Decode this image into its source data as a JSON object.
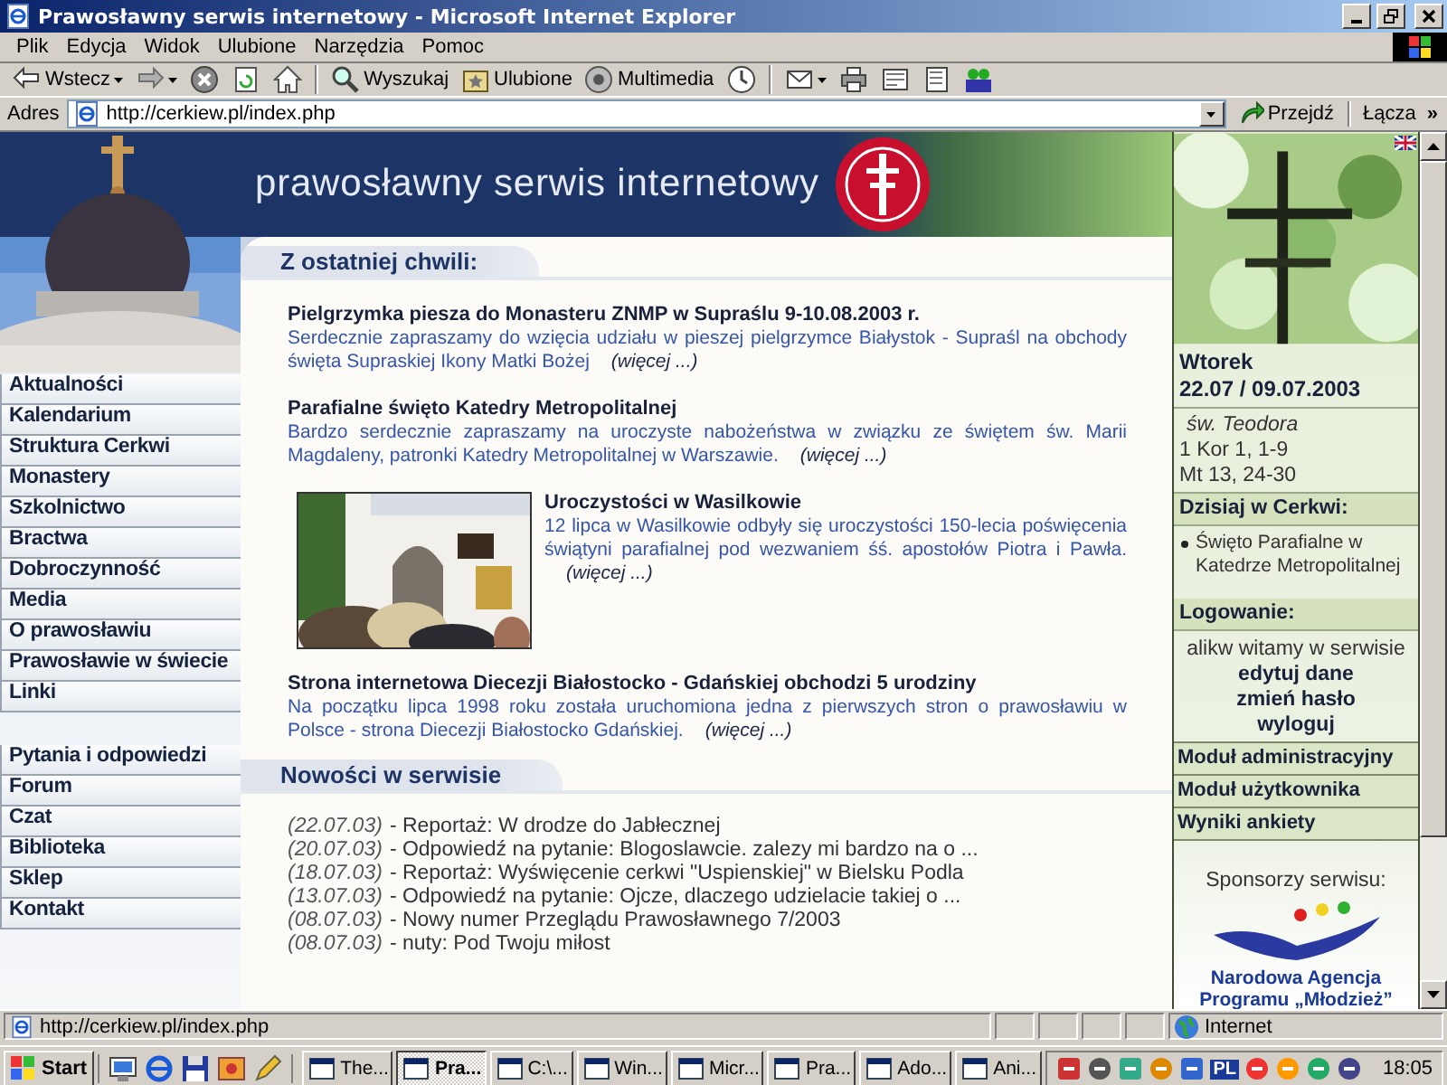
{
  "window": {
    "title": "Prawosławny serwis internetowy - Microsoft Internet Explorer"
  },
  "menu": [
    "Plik",
    "Edycja",
    "Widok",
    "Ulubione",
    "Narzędzia",
    "Pomoc"
  ],
  "toolbar": {
    "back": "Wstecz",
    "search": "Wyszukaj",
    "favorites": "Ulubione",
    "media": "Multimedia"
  },
  "address": {
    "label": "Adres",
    "value": "http://cerkiew.pl/index.php",
    "go": "Przejdź",
    "links": "Łącza",
    "links_more": "»"
  },
  "site": {
    "title": "prawosławny serwis internetowy",
    "nav_primary": [
      "Aktualności",
      "Kalendarium",
      "Struktura Cerkwi",
      "Monastery",
      "Szkolnictwo",
      "Bractwa",
      "Dobroczynność",
      "Media",
      "O prawosławiu",
      "Prawosławie w świecie",
      "Linki"
    ],
    "nav_secondary": [
      "Pytania i odpowiedzi",
      "Forum",
      "Czat",
      "Biblioteka",
      "Sklep",
      "Kontakt"
    ],
    "news": {
      "heading": "Z ostatniej chwili:",
      "items": [
        {
          "kind": "text",
          "title": "Pielgrzymka piesza do Monasteru ZNMP w Supraślu 9-10.08.2003 r.",
          "summary": "Serdecznie zapraszamy do wzięcia udziału w pieszej pielgrzymce Białystok - Supraśl na obchody święta Supraskiej Ikony Matki Bożej",
          "more": "(więcej ...)"
        },
        {
          "kind": "text",
          "title": "Parafialne święto Katedry Metropolitalnej",
          "summary": "Bardzo serdecznie zapraszamy na uroczyste nabożeństwa w związku ze świętem św. Marii Magdaleny, patronki Katedry Metropolitalnej w Warszawie.",
          "more": "(więcej ...)"
        },
        {
          "title": "Uroczystości w Wasilkowie",
          "summary": "12 lipca w Wasilkowie odbyły się uroczystości 150-lecia poświęcenia świątyni parafialnej pod wezwaniem śś. apostołów Piotra i Pawła.",
          "more": "(więcej ...)"
        },
        {
          "kind": "text",
          "title": "Strona internetowa Diecezji Białostocko - Gdańskiej obchodzi 5 urodziny",
          "summary": "Na początku lipca 1998 roku została uruchomiona jedna z pierwszych stron o prawosławiu w Polsce - strona Diecezji Białostocko Gdańskiej.",
          "more": "(więcej ...)"
        }
      ]
    },
    "updates": {
      "heading": "Nowości w serwisie",
      "items": [
        {
          "date": "(22.07.03)",
          "text": "- Reportaż: W drodze do Jabłecznej"
        },
        {
          "date": "(20.07.03)",
          "text": "- Odpowiedź na pytanie: Blogoslawcie. zalezy mi bardzo na o ..."
        },
        {
          "date": "(18.07.03)",
          "text": "- Reportaż: Wyświęcenie cerkwi \"Uspienskiej\" w Bielsku Podla"
        },
        {
          "date": "(13.07.03)",
          "text": "- Odpowiedź na pytanie: Ojcze, dlaczego udzielacie takiej o ..."
        },
        {
          "date": "(08.07.03)",
          "text": "- Nowy numer Przeglądu Prawosławnego 7/2003"
        },
        {
          "date": "(08.07.03)",
          "text": "- nuty: Pod Twoju miłost"
        }
      ]
    },
    "sidebar": {
      "day": "Wtorek",
      "date": "22.07 / 09.07.2003",
      "saint": "św. Teodora",
      "readings": [
        "1 Kor 1, 1-9",
        "Mt 13, 24-30"
      ],
      "today_heading": "Dzisiaj w Cerkwi:",
      "today_items": [
        "Święto Parafialne w Katedrze Metropolitalnej"
      ],
      "login_heading": "Logowanie:",
      "welcome": "alikw witamy w serwisie",
      "login_links": [
        "edytuj dane",
        "zmień hasło",
        "wyloguj"
      ],
      "modules": [
        "Moduł administracyjny",
        "Moduł użytkownika",
        "Wyniki ankiety"
      ],
      "sponsors_heading": "Sponsorzy serwisu:",
      "sponsor_name": [
        "Narodowa Agencja",
        "Programu „Młodzież”"
      ]
    }
  },
  "status_bar": {
    "url": "http://cerkiew.pl/index.php",
    "zone": "Internet"
  },
  "taskbar": {
    "start": "Start",
    "tasks": [
      {
        "label": "The...",
        "selected": false
      },
      {
        "label": "Pra...",
        "selected": true
      },
      {
        "label": "C:\\...",
        "selected": false
      },
      {
        "label": "Win...",
        "selected": false
      },
      {
        "label": "Micr...",
        "selected": false
      },
      {
        "label": "Pra...",
        "selected": false
      },
      {
        "label": "Ado...",
        "selected": false
      },
      {
        "label": "Ani...",
        "selected": false
      }
    ],
    "language": "PL",
    "clock": "18:05"
  }
}
